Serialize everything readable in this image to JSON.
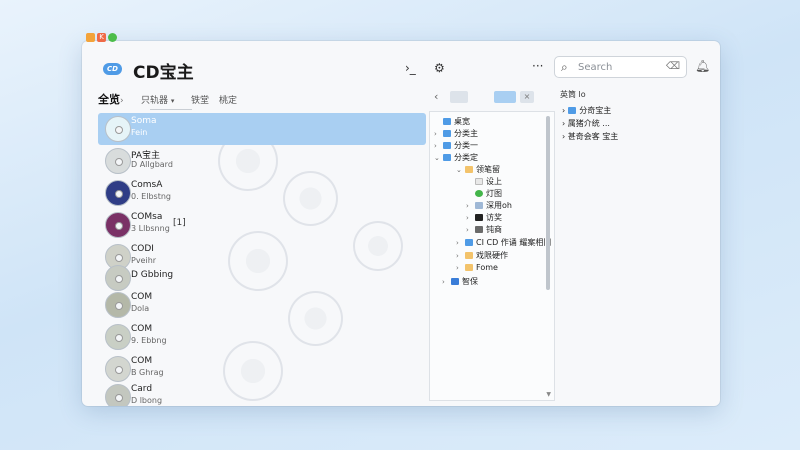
{
  "window": {
    "app_title": "CD宝主",
    "logo_text": "CD"
  },
  "toolbar": {
    "search_placeholder": "Search",
    "more_label": "···"
  },
  "tabs": {
    "main": "全览",
    "main_chevron": "›",
    "items": [
      "只轨器",
      "铁堂",
      "桃定"
    ],
    "dropdown_caret": "▾"
  },
  "list": {
    "rows": [
      {
        "line1": "Soma",
        "line2": "Fein",
        "extra": "",
        "disc_color": "#e6f4f8",
        "selected": true
      },
      {
        "line1": "PA宝主",
        "line2": "D Allgbard",
        "extra": "",
        "disc_color": "#d8dcdc",
        "selected": false
      },
      {
        "line1": "ComsA",
        "line2": "0. Elbstng",
        "extra": "",
        "disc_color": "#2f3d86",
        "selected": false
      },
      {
        "line1": "COMsa",
        "line2": "3 Llbsnng",
        "extra": "[1]",
        "disc_color": "#7a3166",
        "selected": false
      },
      {
        "line1": "CODI",
        "line2": "Pveihr",
        "extra": "",
        "disc_color": "#cfd1c8",
        "selected": false
      },
      {
        "line1": "D Gbbing",
        "line2": "",
        "extra": "",
        "disc_color": "#c7cbc2",
        "selected": false
      },
      {
        "line1": "COM",
        "line2": "Dola",
        "extra": "",
        "disc_color": "#b4b8a8",
        "selected": false
      },
      {
        "line1": "COM",
        "line2": "9. Ebbng",
        "extra": "",
        "disc_color": "#c9cfc5",
        "selected": false
      },
      {
        "line1": "COM",
        "line2": "B Ghrag",
        "extra": "",
        "disc_color": "#d3d6d0",
        "selected": false
      },
      {
        "line1": "Card",
        "line2": "D lbong",
        "extra": "",
        "disc_color": "#c3c7bf",
        "selected": false
      }
    ]
  },
  "tree": {
    "items": [
      {
        "label": "桌宽",
        "arrow": "",
        "color": "#4f9be6",
        "depth": 0
      },
      {
        "label": "分类主",
        "arrow": "›",
        "color": "#4f9be6",
        "depth": 0
      },
      {
        "label": "分类一",
        "arrow": "›",
        "color": "#4f9be6",
        "depth": 0
      },
      {
        "label": "分类定",
        "arrow": "⌄",
        "color": "#4f9be6",
        "depth": 0
      },
      {
        "label": "领笔留",
        "arrow": "⌄",
        "color": "#f3c36b",
        "depth": 1
      },
      {
        "label": "设上",
        "arrow": "",
        "color": "#e8e8e8",
        "depth": 2
      },
      {
        "label": "灯图",
        "arrow": "",
        "color": "#43b54a",
        "depth": 2
      },
      {
        "label": "深用oh",
        "arrow": "›",
        "color": "#9fb8d6",
        "depth": 2
      },
      {
        "label": "访奖",
        "arrow": "›",
        "color": "#222222",
        "depth": 2
      },
      {
        "label": "钝商",
        "arrow": "›",
        "color": "#6a6a6a",
        "depth": 2
      },
      {
        "label": "CI CD 作诵 耀案相旧",
        "arrow": "›",
        "color": "#4f9be6",
        "depth": 1
      },
      {
        "label": "戏限硬作",
        "arrow": "›",
        "color": "#f3c36b",
        "depth": 1
      },
      {
        "label": "Fome",
        "arrow": "›",
        "color": "#f3c36b",
        "depth": 1
      },
      {
        "label": "智保",
        "arrow": "›",
        "color": "#3a7dd8",
        "depth": 0
      }
    ]
  },
  "right_panel": {
    "title": "英筒 lo",
    "items": [
      {
        "arrow": "›",
        "label": "分奇宝主"
      },
      {
        "arrow": "›",
        "label": "属猪介统 ..."
      },
      {
        "arrow": "›",
        "label": "甚奇会客 宝主"
      }
    ]
  },
  "colors": {
    "accent": "#4f9be6",
    "selection": "#a9cff2"
  }
}
